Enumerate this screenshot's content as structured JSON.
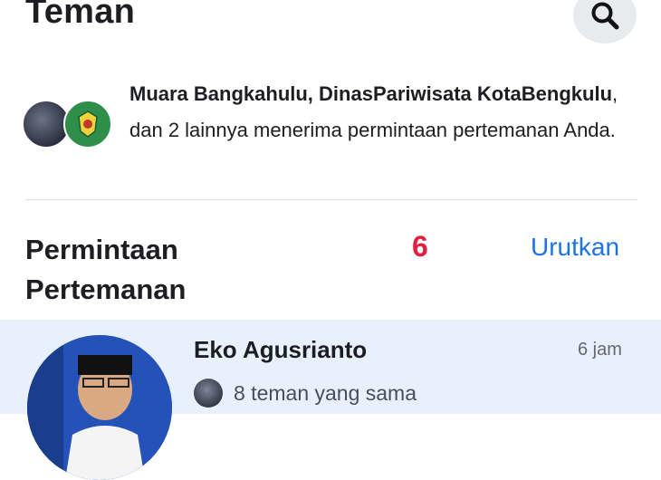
{
  "header": {
    "title": "Teman",
    "search_icon": "search-icon"
  },
  "notification": {
    "bold_1": "Muara Bangkahulu, DinasPariwisata KotaBengkulu",
    "rest": ", dan 2 lainnya menerima permintaan pertemanan Anda."
  },
  "section": {
    "title": "Permintaan Pertemanan",
    "count": "6",
    "sort_label": "Urutkan"
  },
  "request": {
    "name": "Eko Agusrianto",
    "time": "6 jam",
    "mutual": "8 teman yang sama"
  },
  "colors": {
    "accent": "#1b74e4",
    "count": "#e41e3f",
    "row_highlight": "#e7f0fc"
  }
}
